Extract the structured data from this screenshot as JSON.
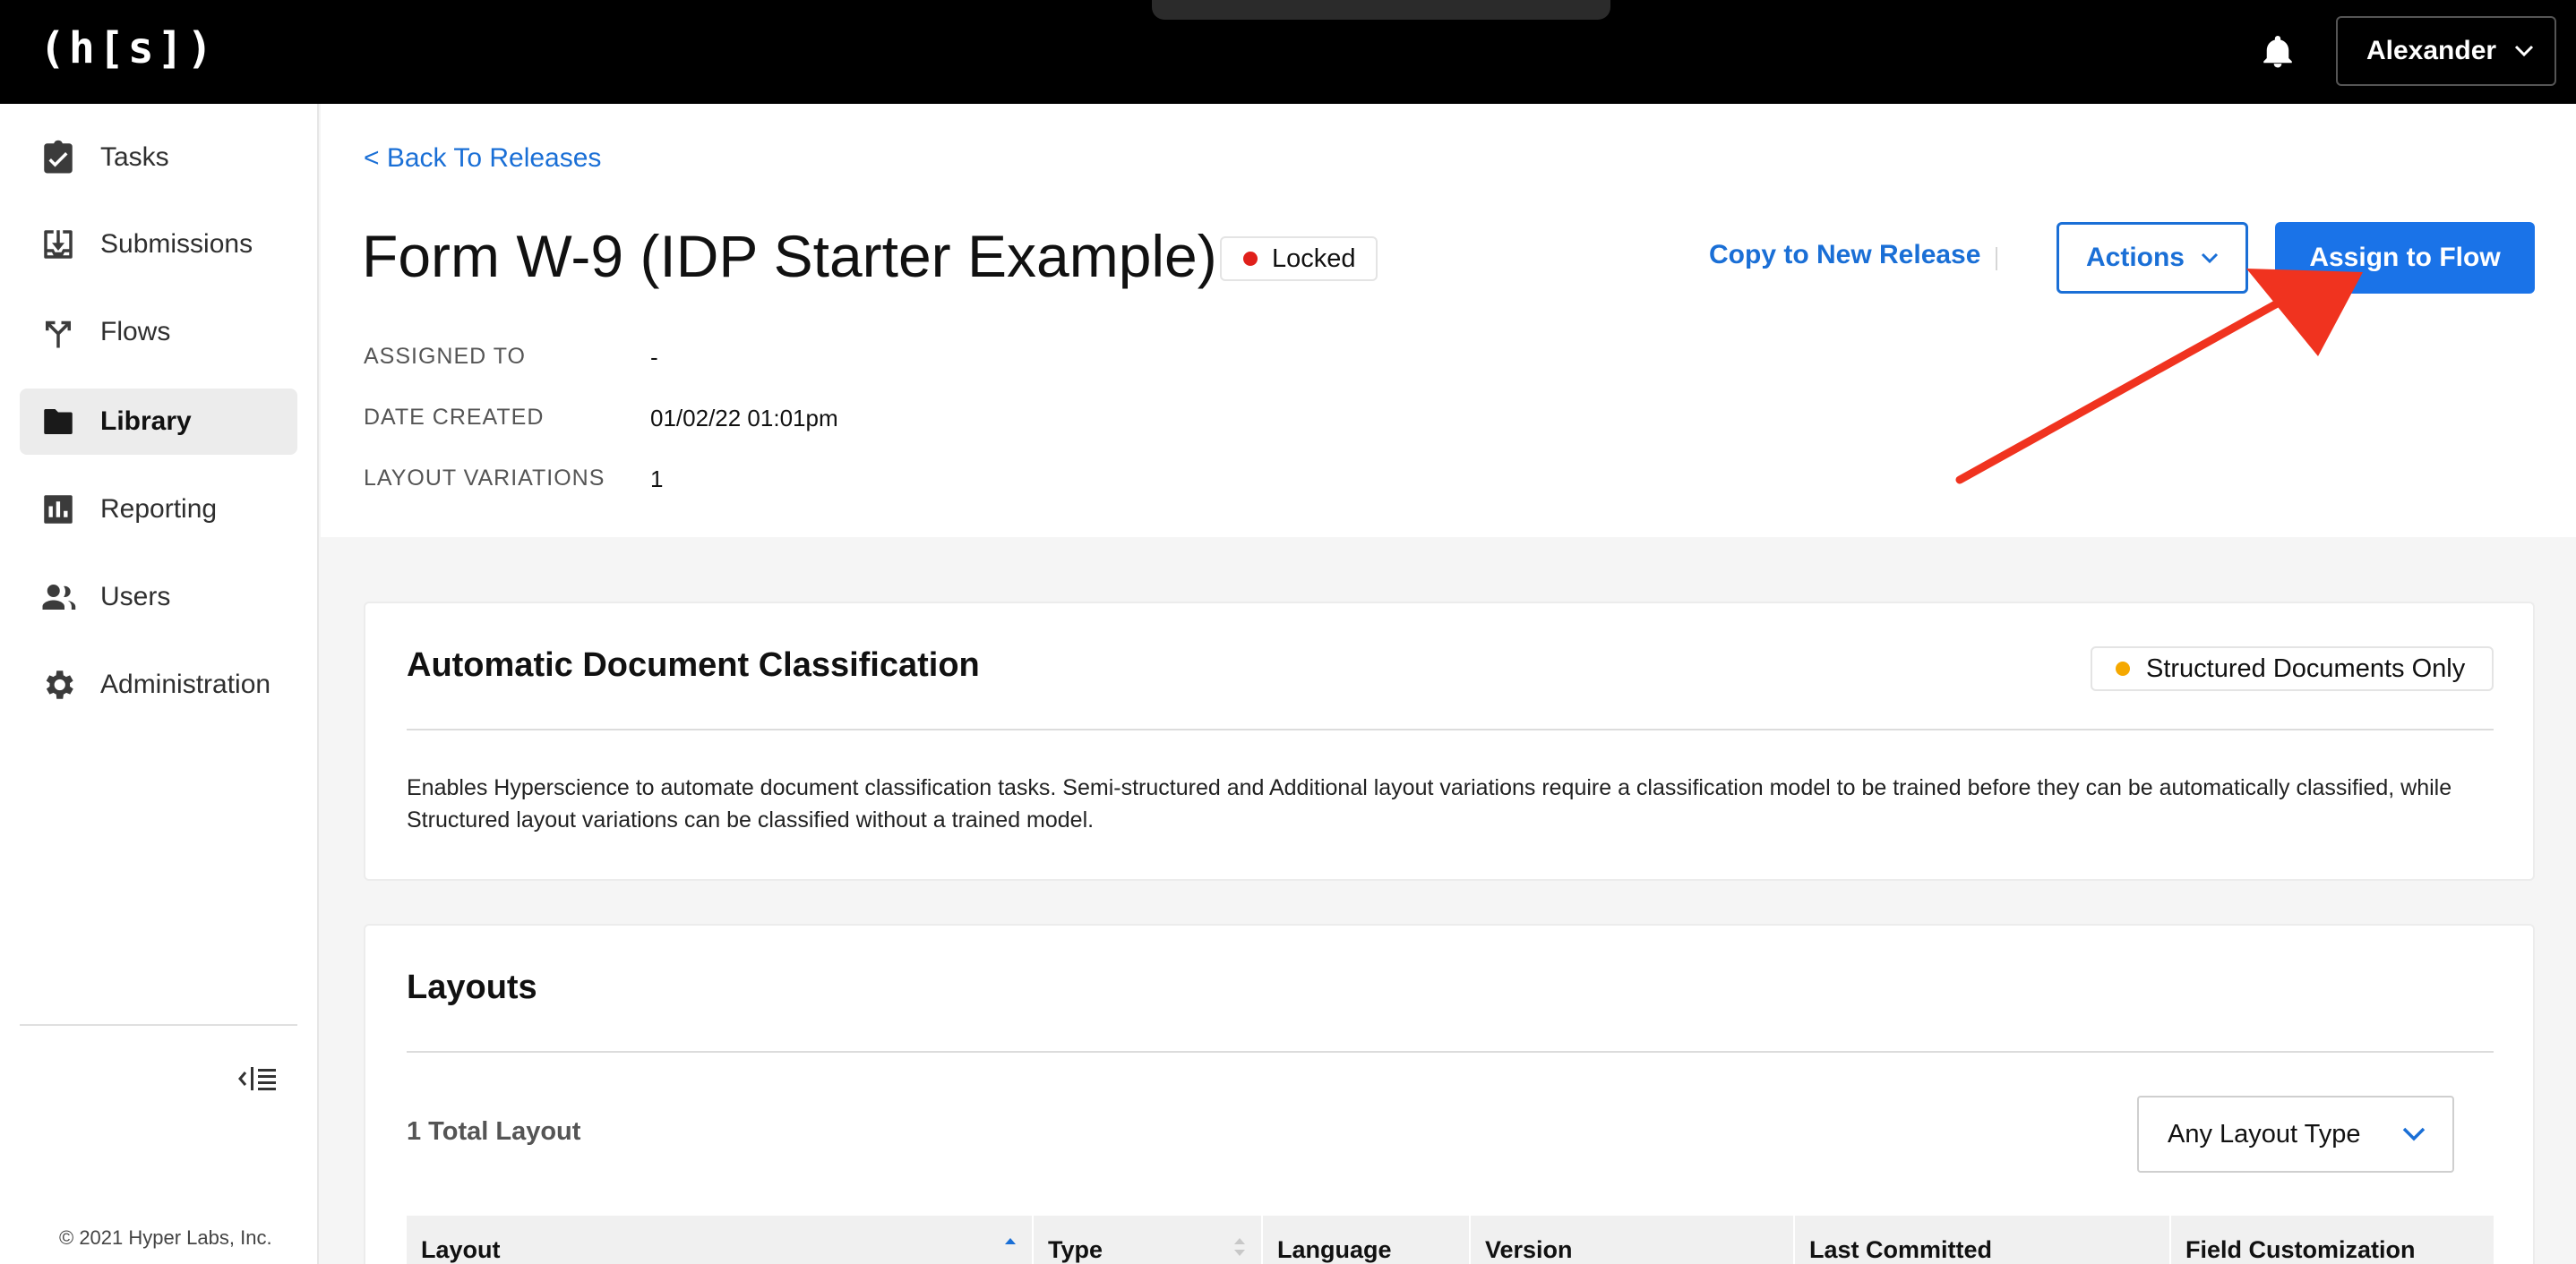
{
  "topbar": {
    "logo": "(h[s])",
    "user_name": "Alexander"
  },
  "sidebar": {
    "items": [
      {
        "label": "Tasks",
        "icon": "clipboard-check-icon"
      },
      {
        "label": "Submissions",
        "icon": "download-tray-icon"
      },
      {
        "label": "Flows",
        "icon": "fork-arrows-icon"
      },
      {
        "label": "Library",
        "icon": "folder-icon",
        "active": true
      },
      {
        "label": "Reporting",
        "icon": "bar-chart-icon"
      },
      {
        "label": "Users",
        "icon": "users-icon"
      },
      {
        "label": "Administration",
        "icon": "gear-icon"
      }
    ],
    "copyright": "© 2021 Hyper Labs, Inc."
  },
  "header": {
    "back_link": "< Back To Releases",
    "title": "Form W-9 (IDP Starter Example)",
    "status": "Locked",
    "status_color": "#e0201b",
    "copy_link": "Copy to New Release",
    "actions_label": "Actions",
    "assign_label": "Assign to Flow",
    "meta": [
      {
        "label": "ASSIGNED TO",
        "value": "-"
      },
      {
        "label": "DATE CREATED",
        "value": "01/02/22 01:01pm"
      },
      {
        "label": "LAYOUT VARIATIONS",
        "value": "1"
      }
    ]
  },
  "classification": {
    "title": "Automatic Document Classification",
    "badge": "Structured Documents Only",
    "badge_color": "#f5a800",
    "description": "Enables Hyperscience to automate document classification tasks. Semi-structured and Additional layout variations require a classification model to be trained before they can be automatically classified, while Structured layout variations can be classified without a trained model."
  },
  "layouts": {
    "title": "Layouts",
    "total": "1 Total Layout",
    "filter_value": "Any Layout Type",
    "columns": [
      "Layout",
      "Type",
      "Language",
      "Version",
      "Last Committed",
      "Field Customization"
    ]
  },
  "colors": {
    "accent": "#1a73e8",
    "link": "#1a6fd6",
    "annotation_arrow": "#f0331f"
  }
}
